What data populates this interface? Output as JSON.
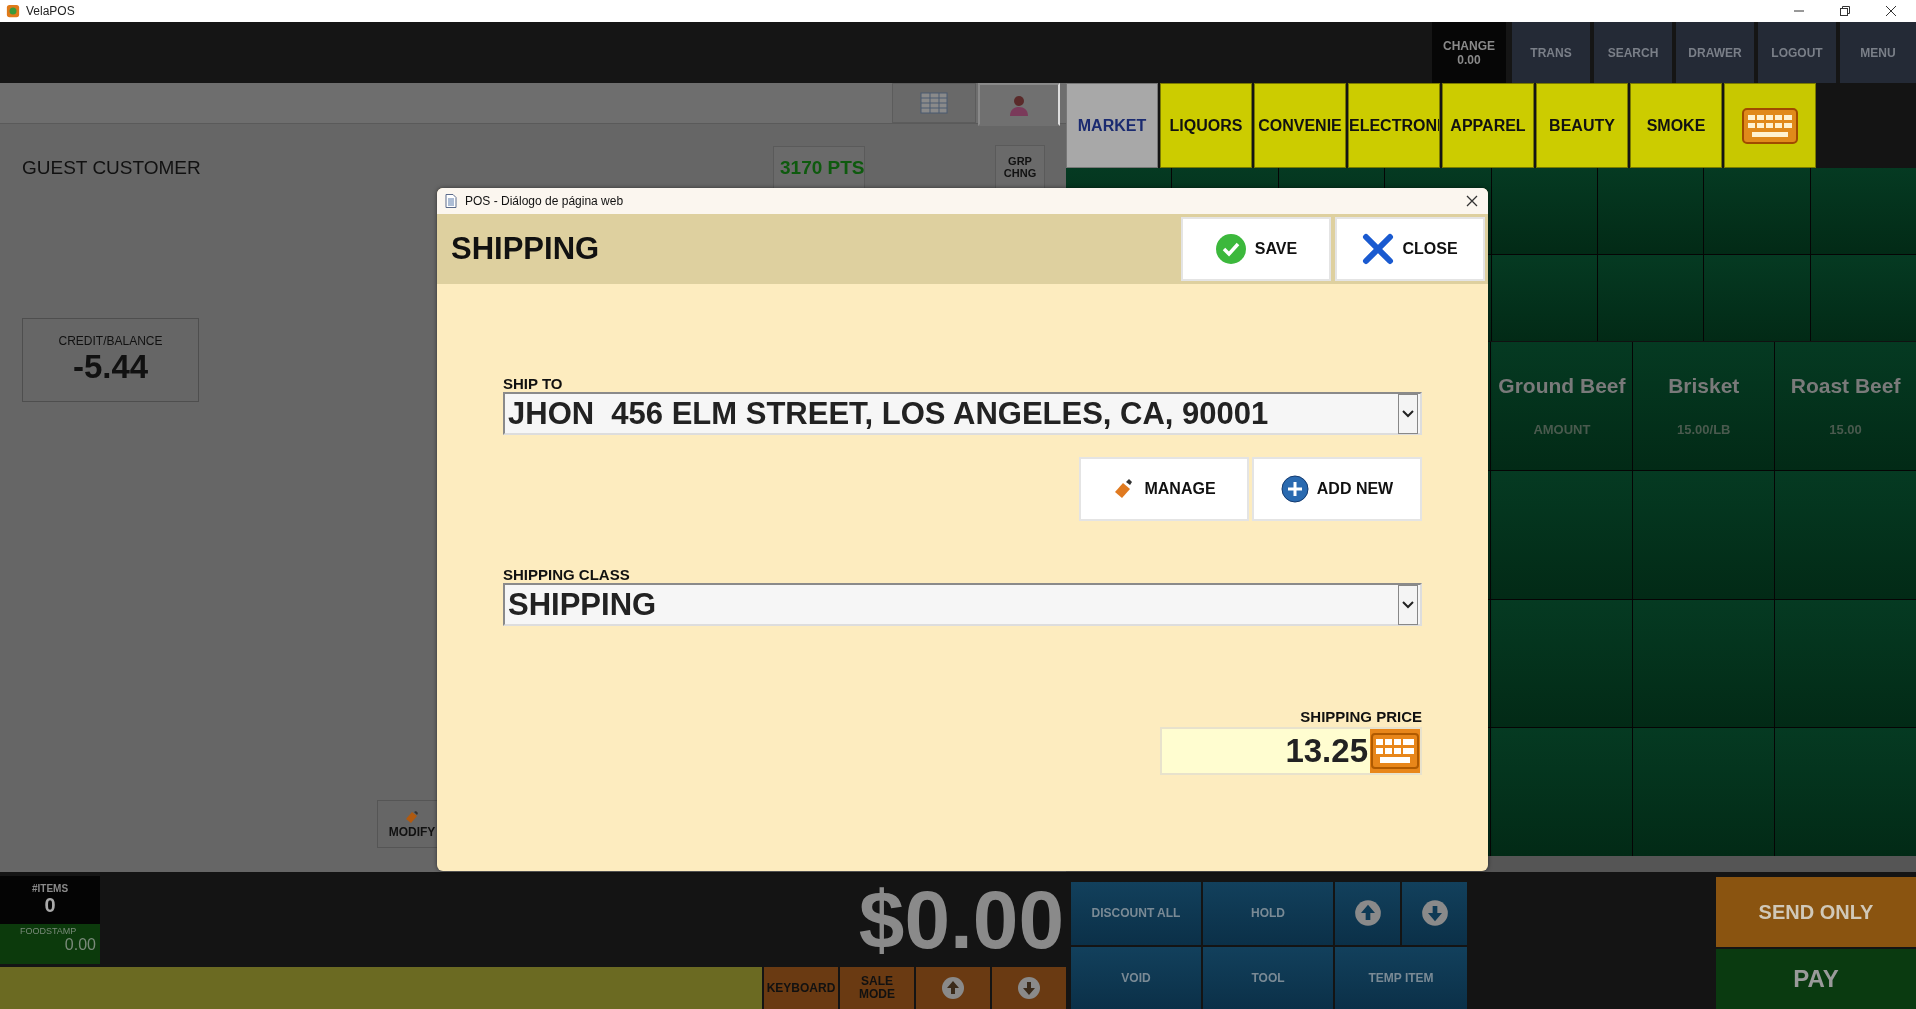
{
  "app_window": {
    "title": "VelaPOS"
  },
  "top_bar": {
    "change": {
      "label": "CHANGE",
      "value": "0.00"
    },
    "buttons": [
      "TRANS",
      "SEARCH",
      "DRAWER",
      "LOGOUT",
      "MENU"
    ]
  },
  "customer": {
    "name": "GUEST CUSTOMER",
    "points": "3170 PTS",
    "group_button": "GRP CHNG",
    "balance_label": "CREDIT/BALANCE",
    "balance": "-5.44",
    "modify_button": "MODIFY"
  },
  "categories": [
    {
      "label": "MARKET",
      "selected": true
    },
    {
      "label": "LIQUORS",
      "selected": false
    },
    {
      "label": "CONVENIE",
      "selected": false
    },
    {
      "label": "ELECTRONI",
      "selected": false
    },
    {
      "label": "APPAREL",
      "selected": false
    },
    {
      "label": "BEAUTY",
      "selected": false
    },
    {
      "label": "SMOKE",
      "selected": false
    }
  ],
  "products": [
    {
      "name": "Ground Beef",
      "price": "AMOUNT"
    },
    {
      "name": "Brisket",
      "price": "15.00/LB"
    },
    {
      "name": "Roast Beef",
      "price": "15.00"
    }
  ],
  "totals": {
    "items_label": "#ITEMS",
    "items": "0",
    "foodstamp_label": "FOODSTAMP",
    "foodstamp": "0.00",
    "total": "$0.00"
  },
  "bottom_buttons": [
    {
      "kind": "text",
      "label": "KEYBOARD"
    },
    {
      "kind": "text",
      "label": "SALE MODE"
    },
    {
      "kind": "up"
    },
    {
      "kind": "down"
    }
  ],
  "action_buttons": [
    {
      "kind": "text",
      "label": "DISCOUNT ALL"
    },
    {
      "kind": "text",
      "label": "HOLD"
    },
    {
      "kind": "up"
    },
    {
      "kind": "down"
    },
    {
      "kind": "text",
      "label": "VOID"
    },
    {
      "kind": "text",
      "label": "TOOL"
    },
    {
      "kind": "text",
      "label": "TEMP ITEM"
    }
  ],
  "pay": {
    "send_only": "SEND ONLY",
    "pay": "PAY"
  },
  "dialog": {
    "window_title": "POS - Diálogo de página web",
    "title": "SHIPPING",
    "save": "SAVE",
    "close": "CLOSE",
    "ship_to": {
      "label": "SHIP TO",
      "value": "JHON  456 ELM STREET, LOS ANGELES, CA, 90001"
    },
    "manage": "MANAGE",
    "add_new": "ADD NEW",
    "shipping_class": {
      "label": "SHIPPING CLASS",
      "value": "SHIPPING"
    },
    "shipping_price": {
      "label": "SHIPPING PRICE",
      "value": "13.25"
    }
  }
}
